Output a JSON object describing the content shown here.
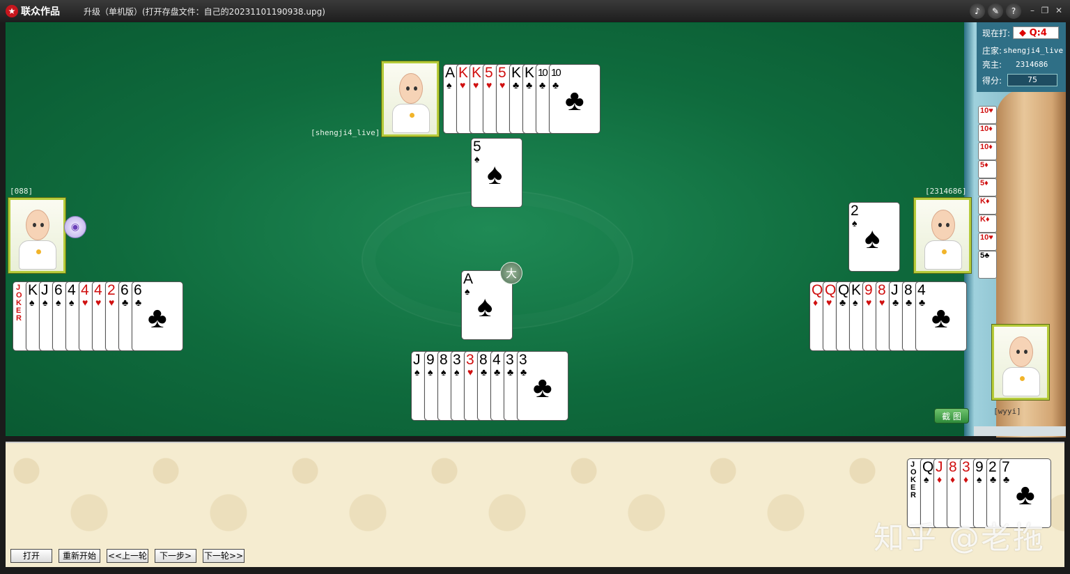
{
  "window": {
    "app_name": "联众作品",
    "title": "升级（单机版）(打开存盘文件：自己的20231101190938.upg)",
    "icons": [
      "speaker-icon",
      "tools-icon",
      "help-icon",
      "minimize-icon",
      "restore-icon",
      "close-icon"
    ]
  },
  "status": {
    "current_play_label": "现在打:",
    "current_play_value": "◆ Q:4",
    "dealer_label": "庄家:",
    "dealer_value": "shengji4_live",
    "trump_label": "亮主:",
    "trump_value": "2314686",
    "score_label": "得分:",
    "score_value": "75"
  },
  "players": {
    "north": "[shengji4_live]",
    "west": "[088]",
    "east": "[2314686]",
    "south": "[wyyi]"
  },
  "labels": {
    "big_marker": "大",
    "screenshot_button": "截 图",
    "watermark": "知乎 @老拖"
  },
  "buttons": [
    "打开",
    "重新开始",
    "<<上一轮",
    "下一步>",
    "下一轮>>"
  ],
  "hands": {
    "north": [
      [
        "A",
        "♠",
        "black"
      ],
      [
        "K",
        "♥",
        "red"
      ],
      [
        "K",
        "♥",
        "red"
      ],
      [
        "5",
        "♥",
        "red"
      ],
      [
        "5",
        "♥",
        "red"
      ],
      [
        "K",
        "♣",
        "black"
      ],
      [
        "K",
        "♣",
        "black"
      ],
      [
        "10",
        "♣",
        "black"
      ],
      [
        "10",
        "♣",
        "black"
      ]
    ],
    "west": [
      [
        "JOKER",
        "",
        "red"
      ],
      [
        "K",
        "♠",
        "black"
      ],
      [
        "J",
        "♠",
        "black"
      ],
      [
        "6",
        "♠",
        "black"
      ],
      [
        "4",
        "♠",
        "black"
      ],
      [
        "4",
        "♥",
        "red"
      ],
      [
        "4",
        "♥",
        "red"
      ],
      [
        "2",
        "♥",
        "red"
      ],
      [
        "6",
        "♣",
        "black"
      ],
      [
        "6",
        "♣",
        "black"
      ]
    ],
    "east": [
      [
        "Q",
        "♦",
        "red"
      ],
      [
        "Q",
        "♥",
        "red"
      ],
      [
        "Q",
        "♣",
        "black"
      ],
      [
        "K",
        "♠",
        "black"
      ],
      [
        "9",
        "♥",
        "red"
      ],
      [
        "8",
        "♥",
        "red"
      ],
      [
        "J",
        "♣",
        "black"
      ],
      [
        "8",
        "♣",
        "black"
      ],
      [
        "4",
        "♣",
        "black"
      ]
    ],
    "south": [
      [
        "J",
        "♠",
        "black"
      ],
      [
        "9",
        "♠",
        "black"
      ],
      [
        "8",
        "♠",
        "black"
      ],
      [
        "3",
        "♠",
        "black"
      ],
      [
        "3",
        "♥",
        "red"
      ],
      [
        "8",
        "♣",
        "black"
      ],
      [
        "4",
        "♣",
        "black"
      ],
      [
        "3",
        "♣",
        "black"
      ],
      [
        "3",
        "♣",
        "black"
      ]
    ],
    "bottom_right": [
      [
        "JOKER",
        "",
        "black"
      ],
      [
        "Q",
        "♠",
        "black"
      ],
      [
        "J",
        "♦",
        "red"
      ],
      [
        "8",
        "♦",
        "red"
      ],
      [
        "3",
        "♦",
        "red"
      ],
      [
        "9",
        "♠",
        "black"
      ],
      [
        "2",
        "♣",
        "black"
      ],
      [
        "7",
        "♣",
        "black"
      ]
    ]
  },
  "played": {
    "north": [
      "5",
      "♠",
      "black"
    ],
    "center": [
      "A",
      "♠",
      "black"
    ],
    "east": [
      "2",
      "♠",
      "black"
    ]
  },
  "kitty": [
    [
      "10",
      "♥",
      "red"
    ],
    [
      "10",
      "♦",
      "red"
    ],
    [
      "10",
      "♦",
      "red"
    ],
    [
      "5",
      "♦",
      "red"
    ],
    [
      "5",
      "♦",
      "red"
    ],
    [
      "K",
      "♦",
      "red"
    ],
    [
      "K",
      "♦",
      "red"
    ],
    [
      "10",
      "♥",
      "red"
    ],
    [
      "5",
      "♣",
      "black"
    ]
  ]
}
